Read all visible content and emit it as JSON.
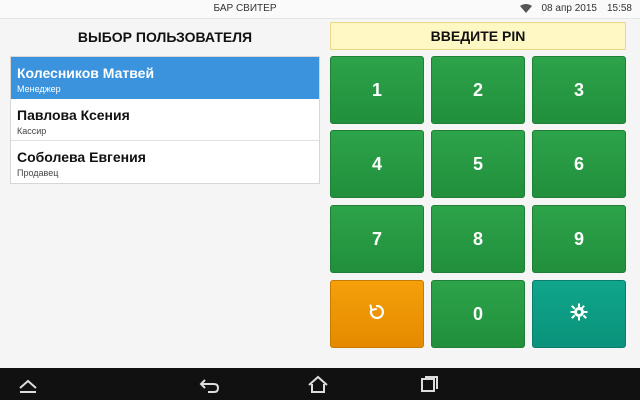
{
  "status": {
    "title": "БАР СВИТЕР",
    "date": "08 апр 2015",
    "time": "15:58"
  },
  "left": {
    "header": "ВЫБОР ПОЛЬЗОВАТЕЛЯ",
    "users": [
      {
        "name": "Колесников Матвей",
        "role": "Менеджер"
      },
      {
        "name": "Павлова Ксения",
        "role": "Кассир"
      },
      {
        "name": "Соболева Евгения",
        "role": "Продавец"
      }
    ],
    "selected_index": 0
  },
  "right": {
    "banner": "ВВЕДИТЕ PIN",
    "keys": [
      "1",
      "2",
      "3",
      "4",
      "5",
      "6",
      "7",
      "8",
      "9",
      "0"
    ],
    "special_keys": {
      "undo_icon": "undo-icon",
      "settings_icon": "gear-icon"
    }
  },
  "colors": {
    "accent_blue": "#3b93de",
    "key_green": "#2da34a",
    "key_orange": "#f4a00a",
    "key_teal": "#10a68b",
    "banner_yellow": "#fff7c4"
  },
  "navbar": {
    "icons": [
      "chevron-up-icon",
      "back-icon",
      "home-icon",
      "recents-icon"
    ]
  }
}
